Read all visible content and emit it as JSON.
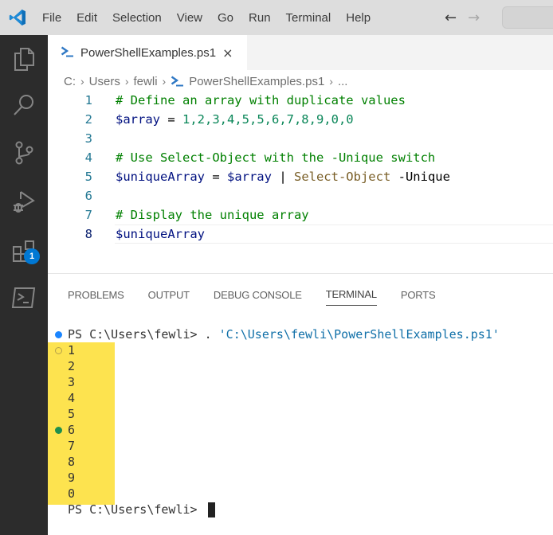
{
  "titlebar": {
    "menu": [
      "File",
      "Edit",
      "Selection",
      "View",
      "Go",
      "Run",
      "Terminal",
      "Help"
    ],
    "back_arrow": "←",
    "forward_arrow": "→",
    "logo_icon": "vscode-logo-icon"
  },
  "activity_bar": {
    "items": [
      {
        "name": "explorer",
        "icon": "files-icon"
      },
      {
        "name": "search",
        "icon": "search-icon"
      },
      {
        "name": "source-control",
        "icon": "source-control-icon"
      },
      {
        "name": "run-and-debug",
        "icon": "run-debug-icon"
      },
      {
        "name": "extensions",
        "icon": "extensions-icon",
        "badge": "1"
      },
      {
        "name": "powershell",
        "icon": "terminal-icon"
      }
    ]
  },
  "editor": {
    "tab": {
      "label": "PowerShellExamples.ps1",
      "icon": "powershell-icon",
      "close": "×"
    },
    "breadcrumb": [
      "C:",
      "Users",
      "fewli",
      "PowerShellExamples.ps1",
      "..."
    ],
    "lines": [
      {
        "n": "1",
        "text": "# Define an array with duplicate values"
      },
      {
        "n": "2",
        "var": "$array",
        "op": " = ",
        "nums": "1,2,3,4,5,5,6,7,8,9,0,0"
      },
      {
        "n": "3",
        "text": ""
      },
      {
        "n": "4",
        "text": "# Use Select-Object with the -Unique switch"
      },
      {
        "n": "5",
        "var": "$uniqueArray",
        "op": " = ",
        "var2": "$array",
        "pipe": " | ",
        "cmd": "Select-Object",
        "param": " -Unique"
      },
      {
        "n": "6",
        "text": ""
      },
      {
        "n": "7",
        "text": "# Display the unique array"
      },
      {
        "n": "8",
        "var": "$uniqueArray"
      }
    ]
  },
  "panel": {
    "tabs": [
      "PROBLEMS",
      "OUTPUT",
      "DEBUG CONSOLE",
      "TERMINAL",
      "PORTS"
    ],
    "active_tab": "TERMINAL",
    "terminal": {
      "command_prompt": "PS C:\\Users\\fewli> . ",
      "command_arg": "'C:\\Users\\fewli\\PowerShellExamples.ps1'",
      "output": [
        "1",
        "2",
        "3",
        "4",
        "5",
        "6",
        "7",
        "8",
        "9",
        "0"
      ],
      "final_prompt": "PS C:\\Users\\fewli> "
    }
  },
  "colors": {
    "comment": "#008000",
    "variable": "#001080",
    "number": "#098658",
    "command": "#795e26",
    "string": "#0f6fa8",
    "highlight": "#fde34f",
    "badge": "#0078d4"
  }
}
